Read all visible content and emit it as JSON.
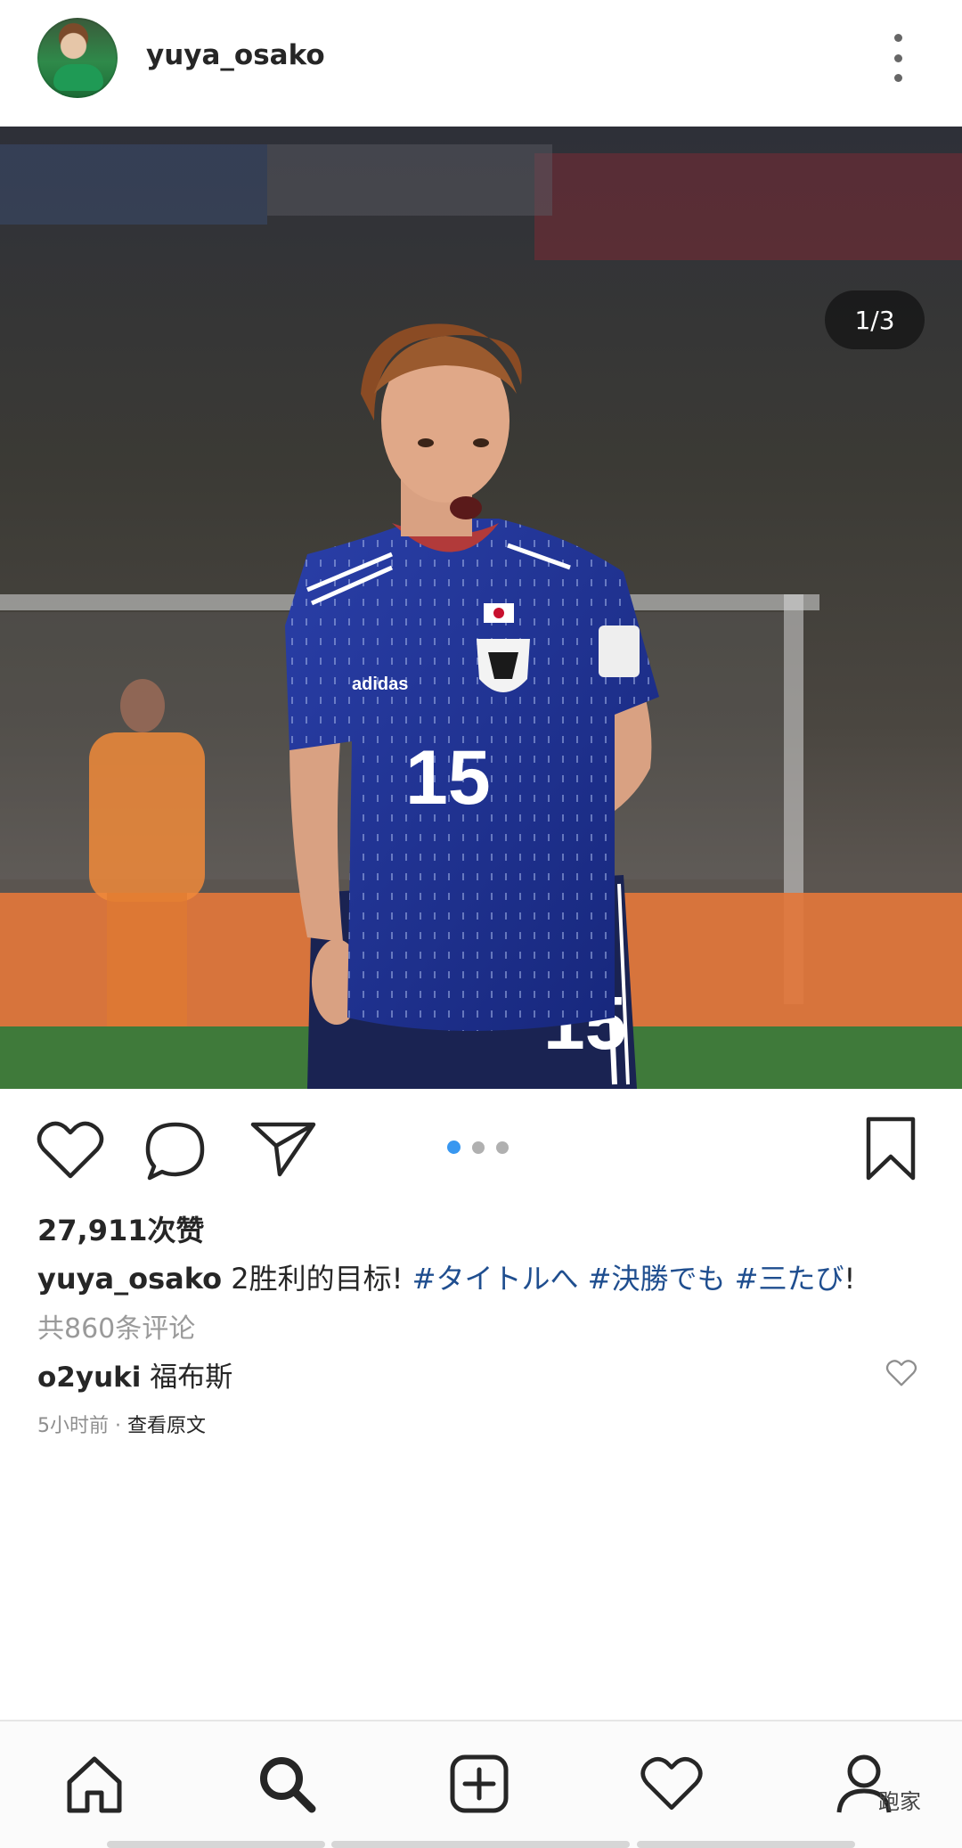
{
  "header": {
    "username": "yuya_osako",
    "avatar_icon": "profile-avatar",
    "more_icon": "more-vertical-icon"
  },
  "post": {
    "image_counter": "1/3",
    "slide_count": 3,
    "active_slide": 1,
    "likes": "27,911次赞",
    "caption": {
      "user": "yuya_osako",
      "text": "2胜利的目标!",
      "tags": [
        "#タイトルへ",
        "#決勝でも",
        "#三たび"
      ],
      "end": "!"
    },
    "view_comments": "共860条评论",
    "comment": {
      "user": "o2yuki",
      "text": "福布斯"
    },
    "time": "5小时前",
    "see_original": "查看原文"
  },
  "actions": {
    "like_icon": "heart-icon",
    "comment_icon": "comment-bubble-icon",
    "share_icon": "paper-plane-icon",
    "save_icon": "bookmark-icon"
  },
  "bottom_nav": {
    "items": [
      "home-icon",
      "search-icon",
      "add-post-icon",
      "activity-heart-icon",
      "profile-icon"
    ],
    "watermark": "跑家"
  },
  "colors": {
    "accent_blue": "#3897f0",
    "hashtag": "#1f4e8f",
    "jersey_blue": "#1c2f8a",
    "pitch_orange": "#e2773b"
  }
}
